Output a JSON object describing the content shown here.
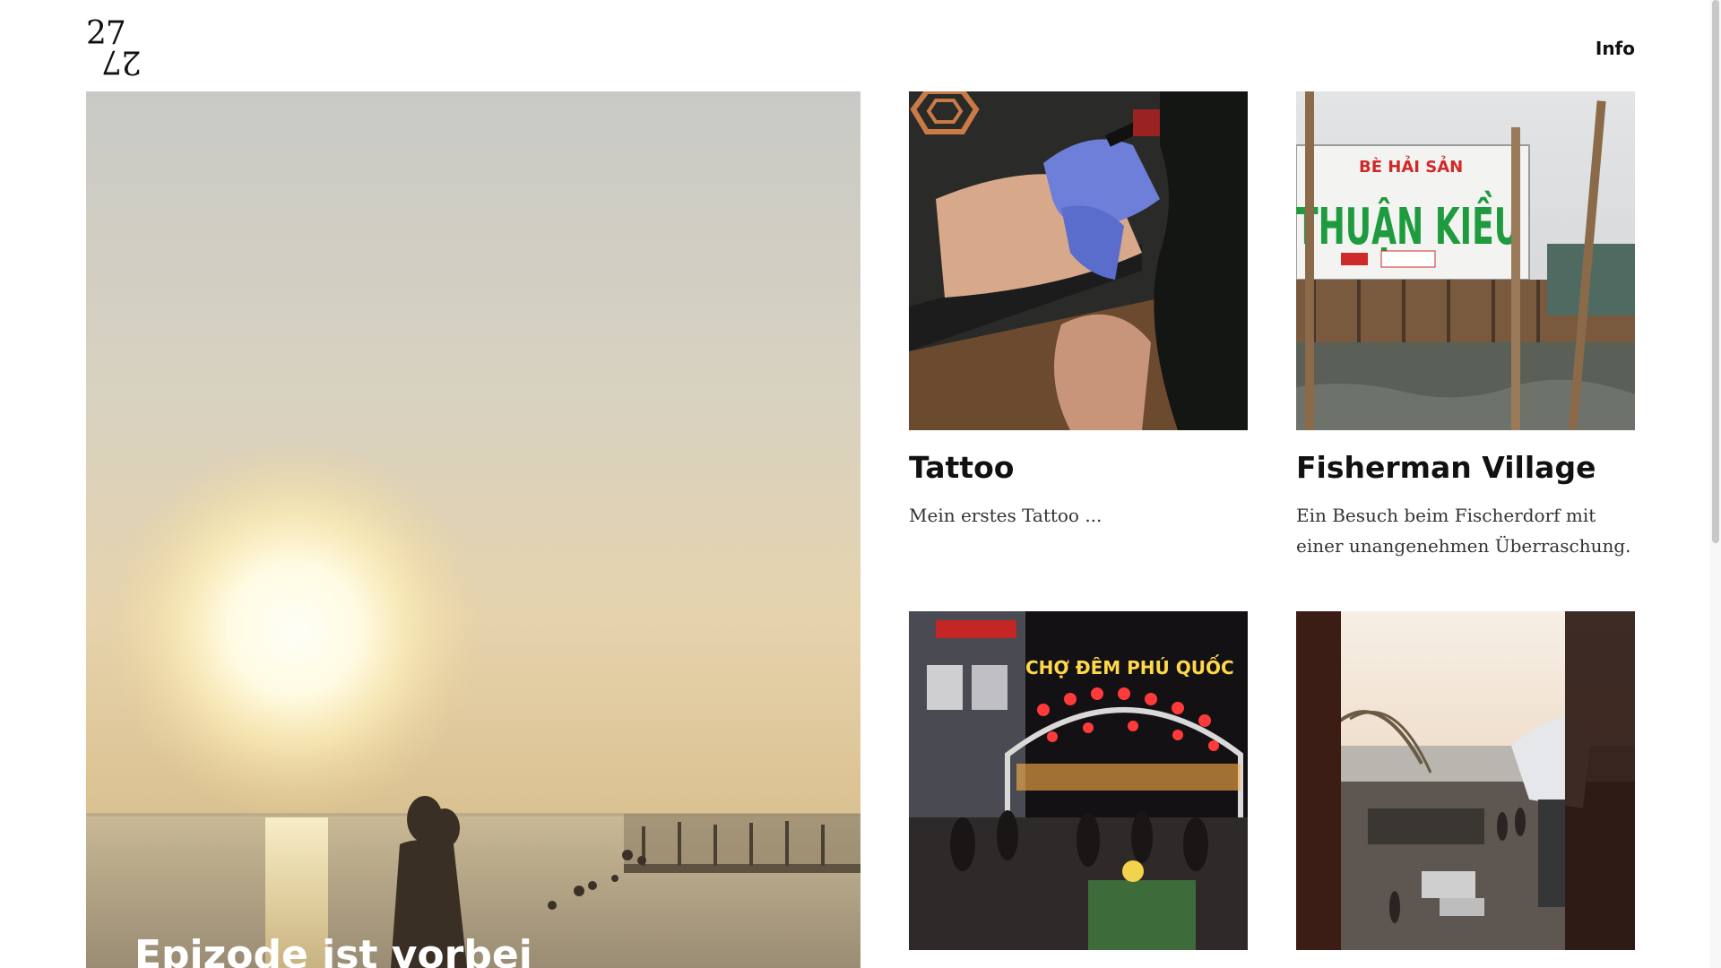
{
  "header": {
    "logo_top": "27",
    "logo_bottom": "27",
    "nav_info": "Info"
  },
  "hero": {
    "title": "Epizode ist vorbei"
  },
  "cards": [
    {
      "title": "Tattoo",
      "description": "Mein erstes Tattoo ..."
    },
    {
      "title": "Fisherman Village",
      "description": "Ein Besuch beim Fischerdorf mit einer unangenehmen Überraschung.",
      "sign_small": "BÈ HẢI SẢN",
      "sign_big": "THUẬN KIỀU"
    },
    {
      "title": "",
      "description": "",
      "sign_text": "CHỢ ĐÊM PHÚ QUỐC"
    },
    {
      "title": "",
      "description": ""
    }
  ],
  "colors": {
    "text": "#111111",
    "background": "#ffffff"
  }
}
